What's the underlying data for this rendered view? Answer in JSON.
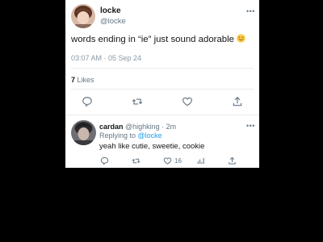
{
  "tweet": {
    "display_name": "locke",
    "handle": "@locke",
    "text": "words ending in “ie” just sound adorable",
    "emoji_icon": "smiling-face-with-smiling-eyes-icon",
    "timestamp": "03:07 AM · 05 Sep 24",
    "likes_count": "7",
    "likes_label": "Likes"
  },
  "reply": {
    "display_name": "cardan",
    "meta": " @highking · 2m",
    "replying_label": "Replying to ",
    "replying_handle": "@locke",
    "text": "yeah like cutie, sweetie, cookie",
    "likes_count": "16"
  },
  "colors": {
    "accent": "#1da1f2",
    "secondary_text": "#657786",
    "primary_text": "#14171a",
    "background": "#000000",
    "card": "#ffffff"
  }
}
